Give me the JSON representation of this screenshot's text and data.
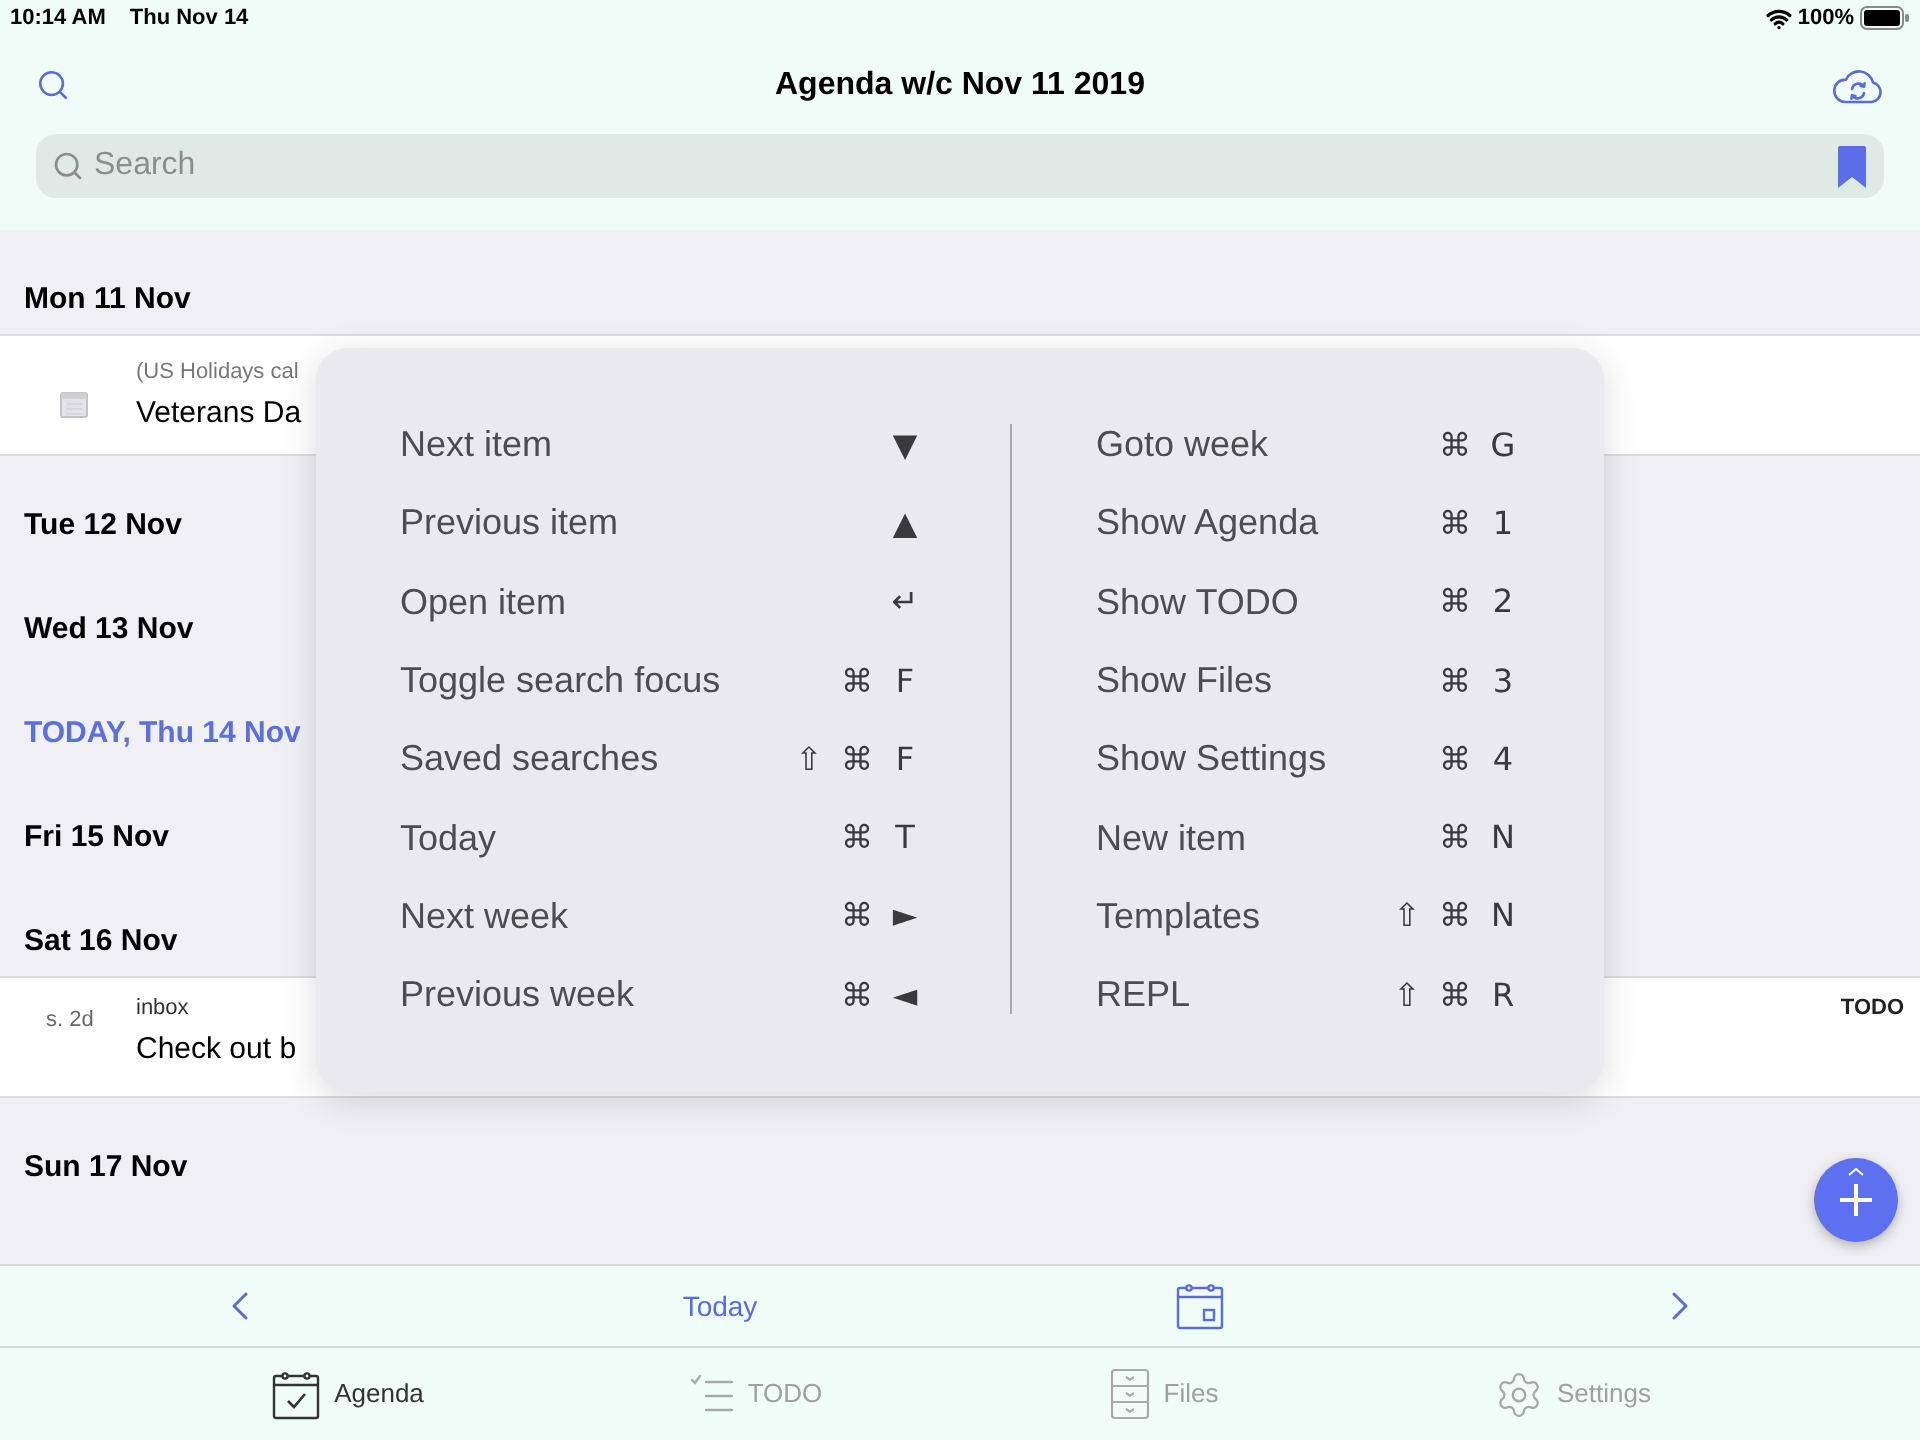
{
  "status_bar": {
    "time": "10:14 AM",
    "date": "Thu Nov 14",
    "battery": "100%"
  },
  "header": {
    "title": "Agenda w/c Nov 11 2019"
  },
  "search": {
    "placeholder": "Search"
  },
  "agenda": {
    "days": [
      {
        "label": "Mon 11 Nov",
        "today": false,
        "items": [
          {
            "kind": "event",
            "calendar": "(US Holidays cal",
            "title": "Veterans Da"
          }
        ]
      },
      {
        "label": "Tue 12 Nov",
        "today": false
      },
      {
        "label": "Wed 13 Nov",
        "today": false
      },
      {
        "label": "TODAY, Thu 14 Nov",
        "today": true
      },
      {
        "label": "Fri 15 Nov",
        "today": false
      },
      {
        "label": "Sat 16 Nov",
        "today": false,
        "items": [
          {
            "kind": "task",
            "scheduled": "s. 2d",
            "category": "inbox",
            "title": "Check out b",
            "state": "TODO"
          }
        ]
      },
      {
        "label": "Sun 17 Nov",
        "today": false
      }
    ]
  },
  "shortcuts": {
    "columns": [
      {
        "items": [
          {
            "label": "Next item",
            "keys": [
              "▼"
            ]
          },
          {
            "label": "Previous item",
            "keys": [
              "▲"
            ]
          },
          {
            "label": "Open item",
            "keys": [
              "↵"
            ]
          },
          {
            "label": "Toggle search focus",
            "keys": [
              "⌘",
              "F"
            ]
          },
          {
            "label": "Saved searches",
            "keys": [
              "⇧",
              "⌘",
              "F"
            ]
          },
          {
            "label": "Today",
            "keys": [
              "⌘",
              "T"
            ]
          },
          {
            "label": "Next week",
            "keys": [
              "⌘",
              "►"
            ]
          },
          {
            "label": "Previous week",
            "keys": [
              "⌘",
              "◄"
            ]
          }
        ]
      },
      {
        "items": [
          {
            "label": "Goto week",
            "keys": [
              "⌘",
              "G"
            ]
          },
          {
            "label": "Show Agenda",
            "keys": [
              "⌘",
              "1"
            ]
          },
          {
            "label": "Show TODO",
            "keys": [
              "⌘",
              "2"
            ]
          },
          {
            "label": "Show Files",
            "keys": [
              "⌘",
              "3"
            ]
          },
          {
            "label": "Show Settings",
            "keys": [
              "⌘",
              "4"
            ]
          },
          {
            "label": "New item",
            "keys": [
              "⌘",
              "N"
            ]
          },
          {
            "label": "Templates",
            "keys": [
              "⇧",
              "⌘",
              "N"
            ]
          },
          {
            "label": "REPL",
            "keys": [
              "⇧",
              "⌘",
              "R"
            ]
          }
        ]
      }
    ]
  },
  "toolbar": {
    "today": "Today"
  },
  "tab_bar": {
    "tabs": [
      {
        "label": "Agenda",
        "selected": true
      },
      {
        "label": "TODO",
        "selected": false
      },
      {
        "label": "Files",
        "selected": false
      },
      {
        "label": "Settings",
        "selected": false
      }
    ]
  }
}
